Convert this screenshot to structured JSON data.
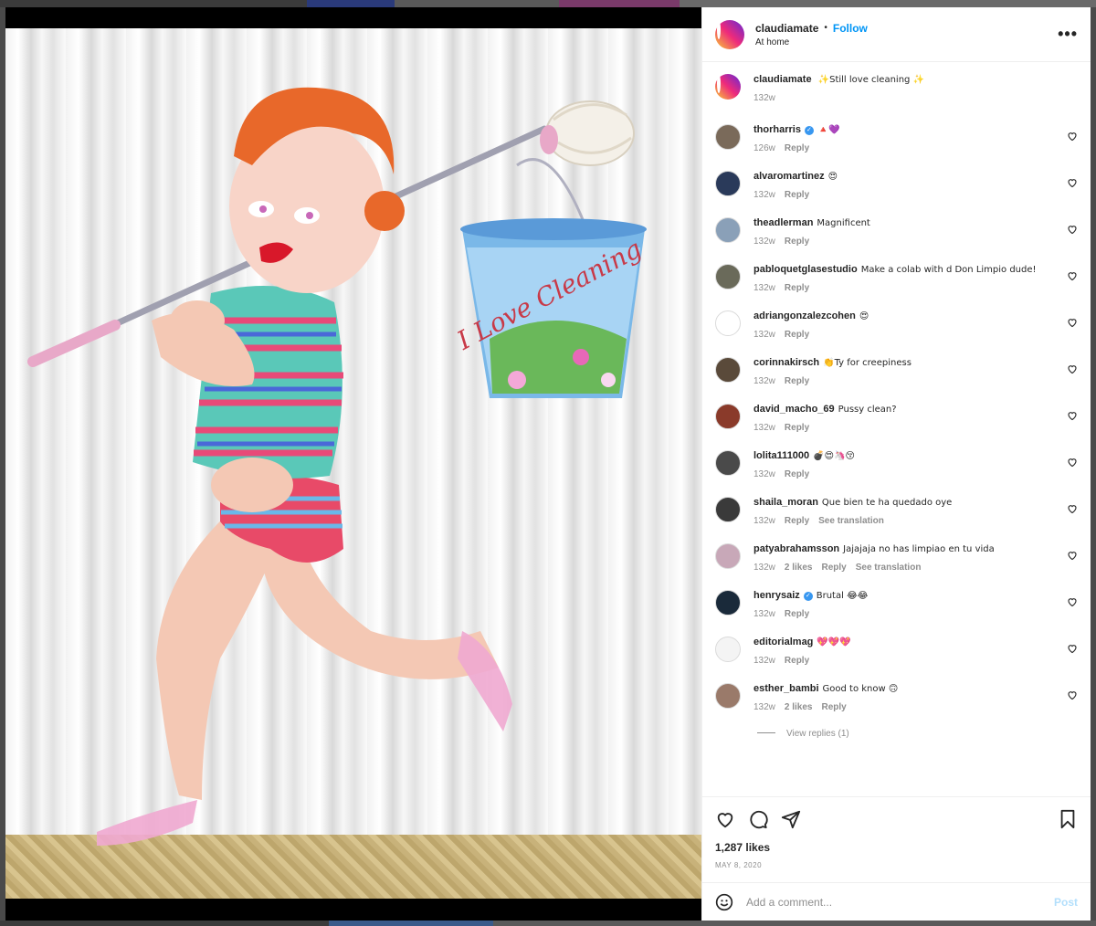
{
  "post": {
    "username": "claudiamate",
    "follow_label": "Follow",
    "location": "At home",
    "more_label": "•••",
    "caption": {
      "username": "claudiamate",
      "text": "✨Still love cleaning ✨",
      "age": "132w"
    },
    "bucket_text": "I Love Cleaning"
  },
  "comments": [
    {
      "user": "thorharris",
      "verified": true,
      "text": "🔺💜",
      "age": "126w",
      "likes": "",
      "reply": "Reply",
      "translation": "",
      "avatar_color": "#7a6a5a"
    },
    {
      "user": "alvaromartinez",
      "verified": false,
      "text": "😍",
      "age": "132w",
      "likes": "",
      "reply": "Reply",
      "translation": "",
      "avatar_color": "#2a3a5a"
    },
    {
      "user": "theadlerman",
      "verified": false,
      "text": "Magnificent",
      "age": "132w",
      "likes": "",
      "reply": "Reply",
      "translation": "",
      "avatar_color": "#8aa0b8"
    },
    {
      "user": "pabloquetglasestudio",
      "verified": false,
      "text": "Make a colab with d Don Limpio dude!",
      "age": "132w",
      "likes": "",
      "reply": "Reply",
      "translation": "",
      "avatar_color": "#6a6a5a"
    },
    {
      "user": "adriangonzalezcohen",
      "verified": false,
      "text": "😍",
      "age": "132w",
      "likes": "",
      "reply": "Reply",
      "translation": "",
      "avatar_color": "#ffffff"
    },
    {
      "user": "corinnakirsch",
      "verified": false,
      "text": "👏Ty for creepiness",
      "age": "132w",
      "likes": "",
      "reply": "Reply",
      "translation": "",
      "avatar_color": "#5a4a3a"
    },
    {
      "user": "david_macho_69",
      "verified": false,
      "text": "Pussy clean?",
      "age": "132w",
      "likes": "",
      "reply": "Reply",
      "translation": "",
      "avatar_color": "#8a3a2a"
    },
    {
      "user": "lolita111000",
      "verified": false,
      "text": "💣😍🦄😚",
      "age": "132w",
      "likes": "",
      "reply": "Reply",
      "translation": "",
      "avatar_color": "#4a4a4a"
    },
    {
      "user": "shaila_moran",
      "verified": false,
      "text": "Que bien te ha quedado oye",
      "age": "132w",
      "likes": "",
      "reply": "Reply",
      "translation": "See translation",
      "avatar_color": "#3a3a3a"
    },
    {
      "user": "patyabrahamsson",
      "verified": false,
      "text": "Jajajaja no has limpiao en tu vida",
      "age": "132w",
      "likes": "2 likes",
      "reply": "Reply",
      "translation": "See translation",
      "avatar_color": "#c8a8b8"
    },
    {
      "user": "henrysaiz",
      "verified": true,
      "text": "Brutal 😂😂",
      "age": "132w",
      "likes": "",
      "reply": "Reply",
      "translation": "",
      "avatar_color": "#1a2a3a"
    },
    {
      "user": "editorialmag",
      "verified": false,
      "text": "💖💖💖",
      "age": "132w",
      "likes": "",
      "reply": "Reply",
      "translation": "",
      "avatar_color": "#f4f4f4"
    },
    {
      "user": "esther_bambi",
      "verified": false,
      "text": "Good to know 🙃",
      "age": "132w",
      "likes": "2 likes",
      "reply": "Reply",
      "translation": "",
      "avatar_color": "#9a7a6a"
    }
  ],
  "view_replies": "View replies (1)",
  "actions": {
    "likes": "1,287 likes",
    "date": "MAY 8, 2020"
  },
  "add_comment": {
    "placeholder": "Add a comment...",
    "post_label": "Post"
  },
  "colors": {
    "accent": "#0095f6",
    "post_disabled": "#b2dffc",
    "muted": "#8e8e8e"
  }
}
